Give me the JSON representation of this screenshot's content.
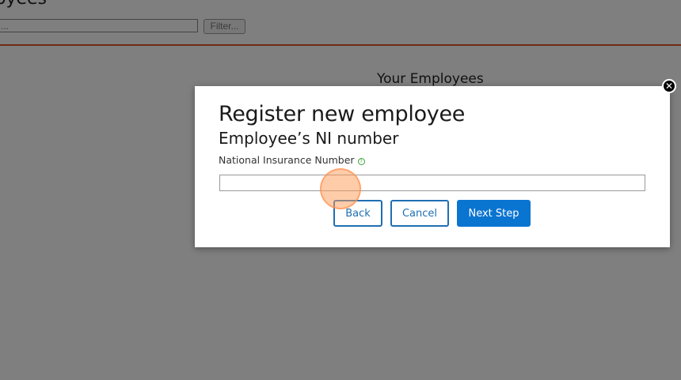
{
  "background": {
    "page_title": "oyees",
    "search_value": "...",
    "filter_label": "Filter...",
    "section_title": "Your Employees",
    "accent_color": "#e0572a"
  },
  "modal": {
    "title": "Register new employee",
    "subtitle": "Employee’s NI number",
    "field_label": "National Insurance Number",
    "help_icon": "help-circle-icon",
    "input_value": "",
    "input_placeholder": "",
    "buttons": {
      "back": "Back",
      "cancel": "Cancel",
      "next": "Next Step"
    },
    "close_icon": "close-icon",
    "primary_color": "#0a74d1"
  }
}
